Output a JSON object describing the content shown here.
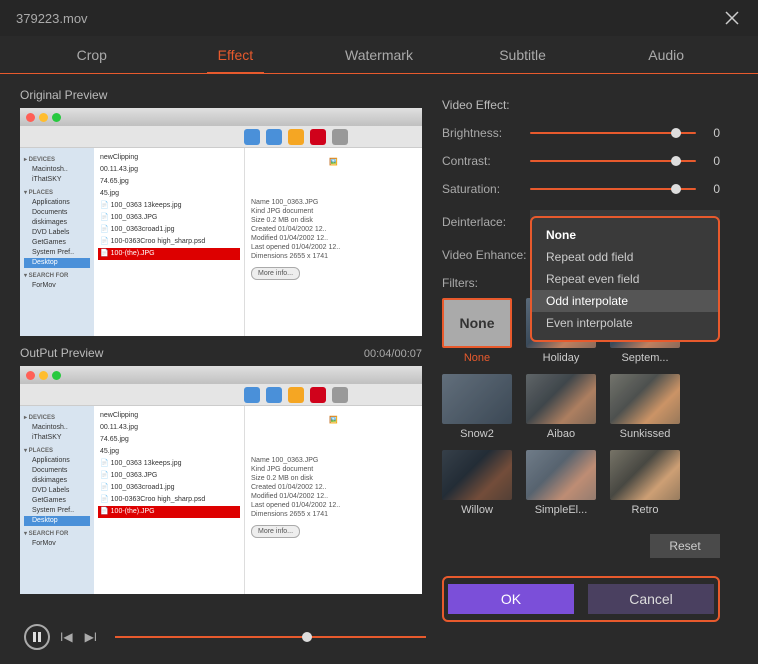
{
  "window": {
    "title": "379223.mov"
  },
  "tabs": [
    "Crop",
    "Effect",
    "Watermark",
    "Subtitle",
    "Audio"
  ],
  "activeTab": "Effect",
  "labels": {
    "originalPreview": "Original Preview",
    "outputPreview": "OutPut Preview",
    "videoEffect": "Video Effect:",
    "brightness": "Brightness:",
    "contrast": "Contrast:",
    "saturation": "Saturation:",
    "deinterlace": "Deinterlace:",
    "videoEnhance": "Video Enhance:",
    "filters": "Filters:",
    "reset": "Reset",
    "ok": "OK",
    "cancel": "Cancel"
  },
  "values": {
    "brightness": "0",
    "contrast": "0",
    "saturation": "0",
    "deinterlaceSelected": "None",
    "time": "00:04/00:07"
  },
  "deinterlaceOptions": [
    "None",
    "Repeat odd field",
    "Repeat even field",
    "Odd interpolate",
    "Even interpolate"
  ],
  "filters": [
    {
      "key": "none",
      "name": "None"
    },
    {
      "key": "holiday",
      "name": "Holiday"
    },
    {
      "key": "september",
      "name": "Septem..."
    },
    {
      "key": "snow2",
      "name": "Snow2"
    },
    {
      "key": "aibao",
      "name": "Aibao"
    },
    {
      "key": "sunkissed",
      "name": "Sunkissed"
    },
    {
      "key": "willow",
      "name": "Willow"
    },
    {
      "key": "simple",
      "name": "SimpleEl..."
    },
    {
      "key": "retro",
      "name": "Retro"
    }
  ],
  "preview": {
    "sidebar": {
      "sections": [
        {
          "header": "DEVICES",
          "items": [
            "Macintosh HD",
            "iThatSKY"
          ]
        },
        {
          "header": "PLACES",
          "items": [
            "Applications",
            "Documents",
            "diskimages",
            "DVD Labels",
            "GetGames",
            "System Prefer",
            "Desktop"
          ]
        },
        {
          "header": "SEARCH FOR",
          "items": [
            "ForMov"
          ]
        }
      ],
      "selected": "Desktop"
    },
    "filelist": {
      "items": [
        "newClipping",
        "00.11.43.jpg",
        "74.65.jpg",
        "45.jpg",
        "100_0363 13keeps.jpg",
        "100_0363.JPG",
        "100_0363croad1.jpg",
        "100-0363Croo high_sharp.psd",
        "100-(the).JPG"
      ],
      "selected": "100-(the).JPG"
    },
    "details": {
      "name": "Name 100_0363.JPG",
      "kind": "Kind JPG document",
      "size": "Size 0.2 MB on disk",
      "created": "Created 01/04/2002 12...",
      "modified": "Modified 01/04/2002 12...",
      "lastOpened": "Last opened 01/04/2002 12...",
      "dimensions": "Dimensions 2655 x 1741",
      "btn": "More info..."
    }
  }
}
